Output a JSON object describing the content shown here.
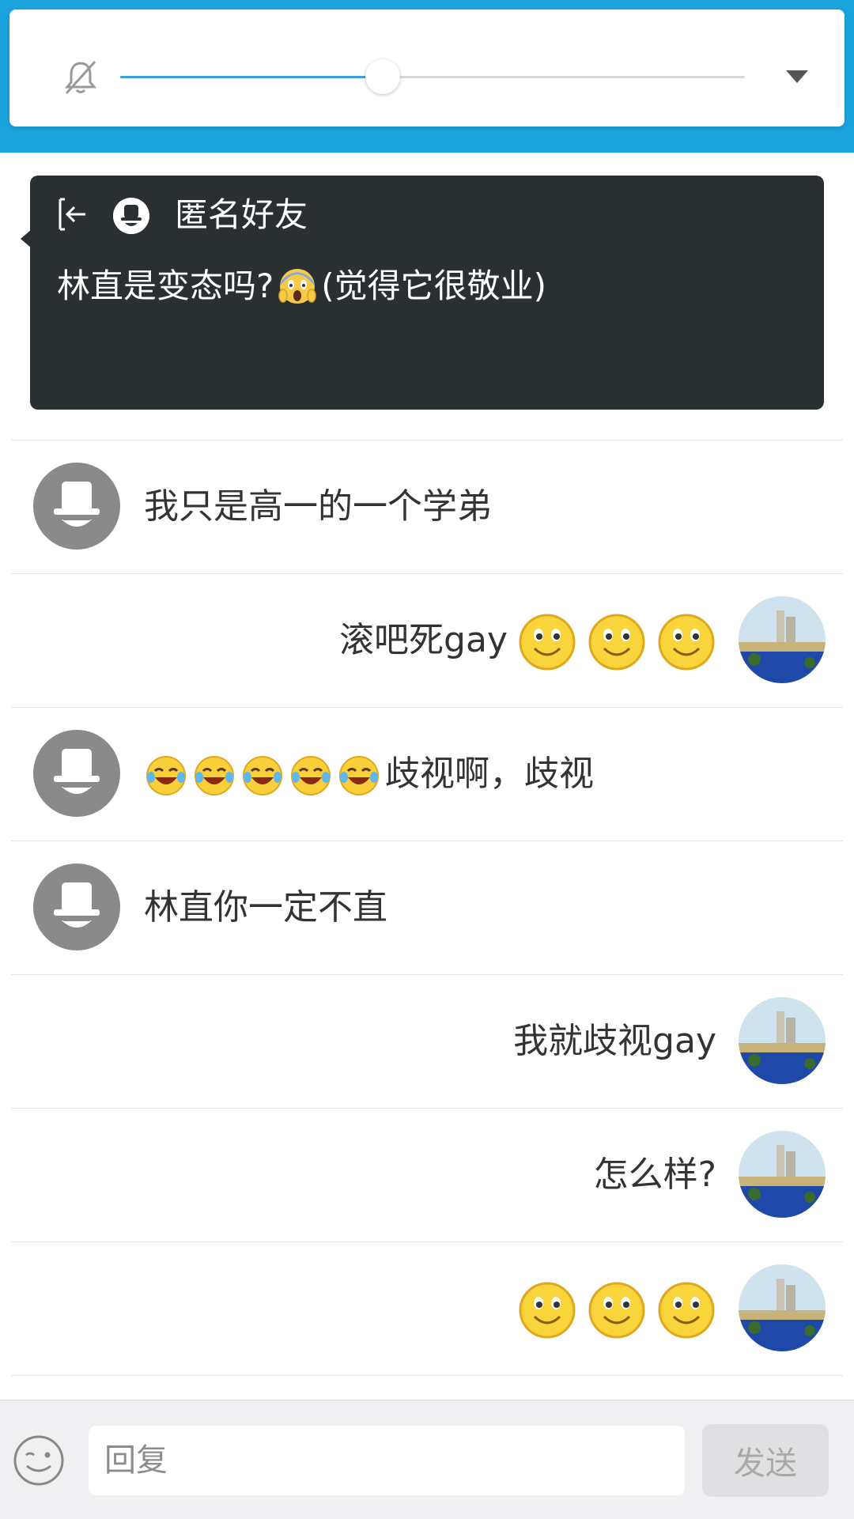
{
  "volume_panel": {
    "level": 0.42
  },
  "notification": {
    "sender": "匿名好友",
    "message_before_emoji": "林直是变态吗?",
    "message_after_emoji": "(觉得它很敬业)",
    "emoji": "scream-emoji"
  },
  "messages": [
    {
      "side": "left",
      "text": "我只是高一的一个学弟"
    },
    {
      "side": "right",
      "text": "滚吧死gay",
      "trailing_emojis": [
        "smile-emoji",
        "smile-emoji",
        "smile-emoji"
      ]
    },
    {
      "side": "left",
      "leading_emojis": [
        "laugh-cry-emoji",
        "laugh-cry-emoji",
        "laugh-cry-emoji",
        "laugh-cry-emoji",
        "laugh-cry-emoji"
      ],
      "text": "歧视啊，歧视"
    },
    {
      "side": "left",
      "text": "林直你一定不直"
    },
    {
      "side": "right",
      "text": "我就歧视gay"
    },
    {
      "side": "right",
      "text": "怎么样?"
    },
    {
      "side": "right",
      "text": "",
      "trailing_emojis": [
        "smile-emoji",
        "smile-emoji",
        "smile-emoji"
      ]
    }
  ],
  "input_bar": {
    "placeholder": "回复",
    "send_label": "发送"
  },
  "colors": {
    "top_strip": "#1aa3dc",
    "notification_bg": "#2a2f32",
    "slider_fill": "#3aa0d8"
  }
}
